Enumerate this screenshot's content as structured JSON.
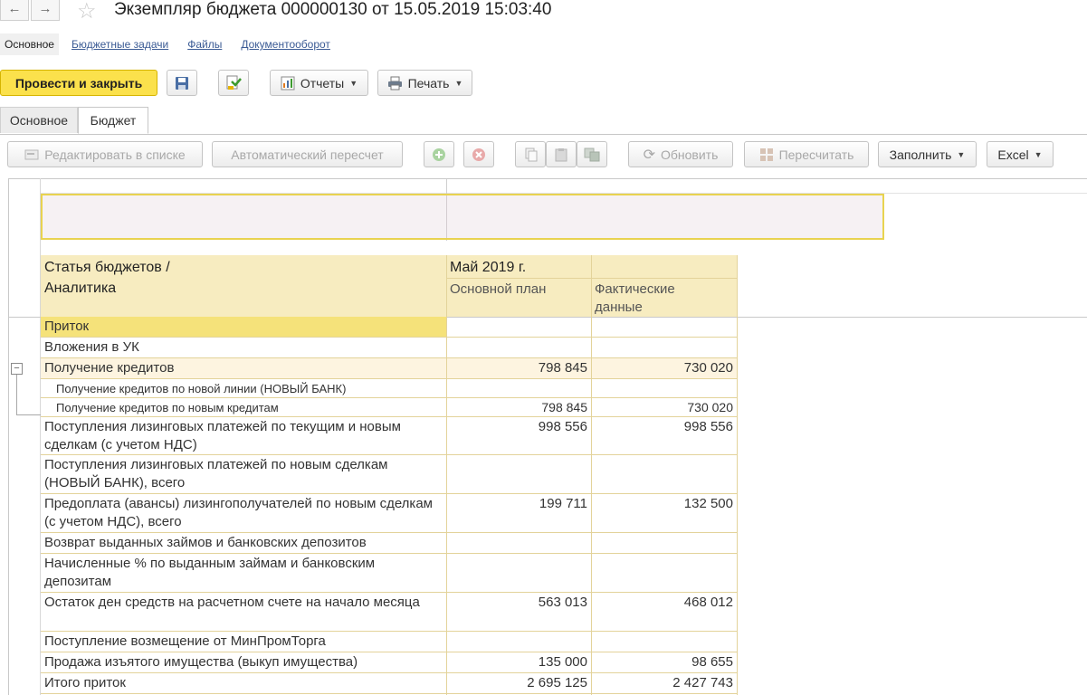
{
  "window": {
    "title": "Экземпляр бюджета 000000130 от 15.05.2019 15:03:40",
    "back_icon": "←",
    "forward_icon": "→",
    "favorite_icon": "☆"
  },
  "nav": {
    "links": [
      "Основное",
      "Бюджетные задачи",
      "Файлы",
      "Документооборот"
    ]
  },
  "toolbar": {
    "post_close": "Провести и закрыть",
    "reports": "Отчеты",
    "print": "Печать"
  },
  "tabs": [
    "Основное",
    "Бюджет"
  ],
  "budget_toolbar": {
    "edit_in_list": "Редактировать в списке",
    "auto_recalc": "Автоматический пересчет",
    "refresh": "Обновить",
    "recalc": "Пересчитать",
    "fill": "Заполнить",
    "excel": "Excel"
  },
  "table": {
    "header_col1_line1": "Статья бюджетов /",
    "header_col1_line2": "Аналитика",
    "period": "Май 2019 г.",
    "col_plan": "Основной план",
    "col_fact_line1": "Фактические",
    "col_fact_line2": "данные",
    "collapse_icon": "⊟",
    "rows": [
      {
        "name": "Приток",
        "plan": "",
        "fact": ""
      },
      {
        "name": "Вложения в УК",
        "plan": "",
        "fact": ""
      },
      {
        "name": "Получение кредитов",
        "plan": "798 845",
        "fact": "730 020"
      },
      {
        "name": "Получение кредитов по новой линии (НОВЫЙ БАНК)",
        "plan": "",
        "fact": ""
      },
      {
        "name": "Получение кредитов по новым кредитам",
        "plan": "798 845",
        "fact": "730 020"
      },
      {
        "name": "Поступления лизинговых платежей по текущим и новым сделкам (с учетом НДС)",
        "plan": "998 556",
        "fact": "998 556"
      },
      {
        "name": "Поступления лизинговых платежей по новым сделкам (НОВЫЙ БАНК), всего",
        "plan": "",
        "fact": ""
      },
      {
        "name": "Предоплата (авансы) лизингополучателей по новым сделкам (с учетом НДС), всего",
        "plan": "199 711",
        "fact": "132 500"
      },
      {
        "name": "Возврат выданных займов и банковских депозитов",
        "plan": "",
        "fact": ""
      },
      {
        "name": "Начисленные % по выданным займам и банковским депозитам",
        "plan": "",
        "fact": ""
      },
      {
        "name": "Остаток ден средств на расчетном счете на начало месяца",
        "plan": "563 013",
        "fact": "468 012"
      },
      {
        "name": "Поступление возмещение от МинПромТорга",
        "plan": "",
        "fact": ""
      },
      {
        "name": "Продажа изъятого имущества (выкуп имущества)",
        "plan": "135 000",
        "fact": "98 655"
      },
      {
        "name": "Итого приток",
        "plan": "2 695 125",
        "fact": "2 427 743"
      }
    ]
  },
  "colors": {
    "accent_yellow": "#fbe14c",
    "header_fill": "#f7ecc0",
    "highlight_row": "#fdf4e0",
    "selected_cell": "#f5e27a",
    "focus_border": "#e8d350"
  }
}
